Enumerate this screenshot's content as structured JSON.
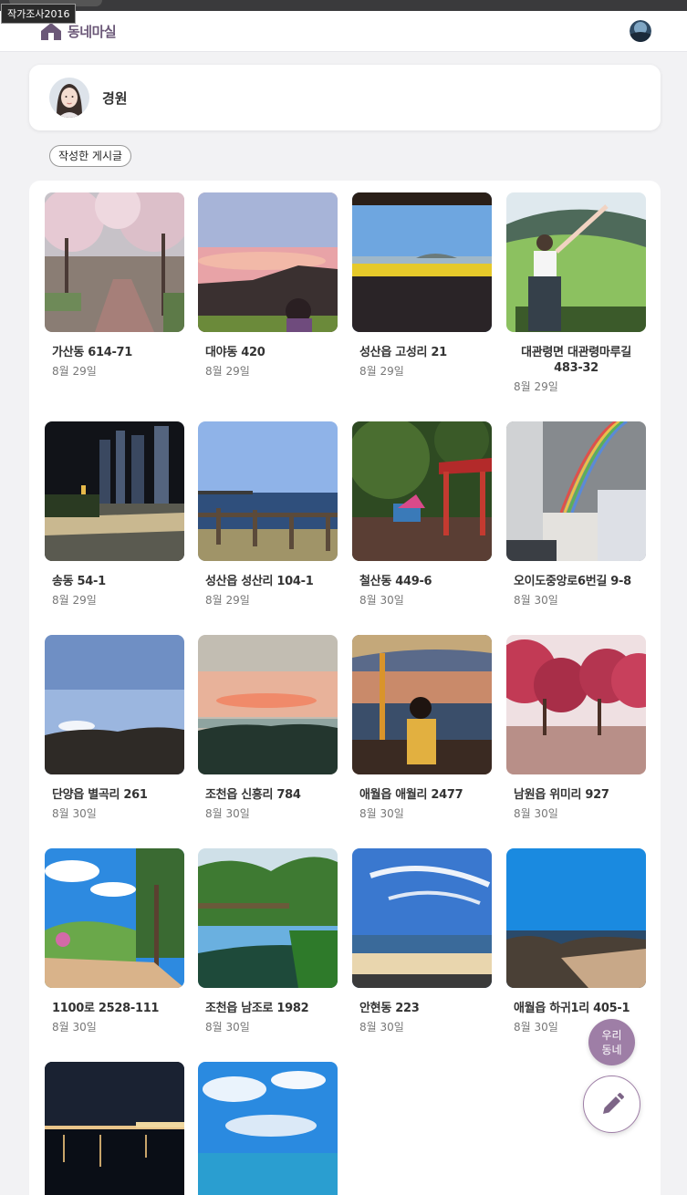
{
  "browser": {
    "tooltip": "작가조사2016"
  },
  "app": {
    "logo_text": "동네마실"
  },
  "profile": {
    "name": "경원"
  },
  "tabs": [
    {
      "label": "작성한 게시글"
    }
  ],
  "posts": [
    {
      "address": "가산동 614-71",
      "date": "8월 29일",
      "photo": "cherry-blossom-path"
    },
    {
      "address": "대야동 420",
      "date": "8월 29일",
      "photo": "sunset-pink-sky"
    },
    {
      "address": "성산읍 고성리 21",
      "date": "8월 29일",
      "photo": "yellow-flowers-sea"
    },
    {
      "address": "대관령면 대관령마루길 483-32",
      "date": "8월 29일",
      "photo": "green-hill-person"
    },
    {
      "address": "송동 54-1",
      "date": "8월 29일",
      "photo": "night-park"
    },
    {
      "address": "성산읍 성산리 104-1",
      "date": "8월 29일",
      "photo": "sea-fence"
    },
    {
      "address": "철산동 449-6",
      "date": "8월 30일",
      "photo": "playground"
    },
    {
      "address": "오이도중앙로6번길 9-8",
      "date": "8월 30일",
      "photo": "rainbow-buildings"
    },
    {
      "address": "단양읍 별곡리 261",
      "date": "8월 30일",
      "photo": "blue-sky-mountain"
    },
    {
      "address": "조천읍 신흥리 784",
      "date": "8월 30일",
      "photo": "sunset-rocks"
    },
    {
      "address": "애월읍 애월리 2477",
      "date": "8월 30일",
      "photo": "cafe-sunset"
    },
    {
      "address": "남원읍 위미리 927",
      "date": "8월 30일",
      "photo": "camellia-forest"
    },
    {
      "address": "1100로 2528-111",
      "date": "8월 30일",
      "photo": "trees-clouds"
    },
    {
      "address": "조천읍 남조로 1982",
      "date": "8월 30일",
      "photo": "pond-reflection"
    },
    {
      "address": "안현동 223",
      "date": "8월 30일",
      "photo": "beach-clouds"
    },
    {
      "address": "애월읍 하귀1리 405-1",
      "date": "8월 30일",
      "photo": "rocky-coast"
    },
    {
      "address": "",
      "date": "",
      "photo": "night-bridge"
    },
    {
      "address": "",
      "date": "",
      "photo": "sky-sea"
    }
  ],
  "fab": {
    "town_label_1": "우리",
    "town_label_2": "동네",
    "write_icon": "pencil-icon"
  },
  "colors": {
    "accent": "#9e7ea6",
    "logo": "#6b5878"
  }
}
